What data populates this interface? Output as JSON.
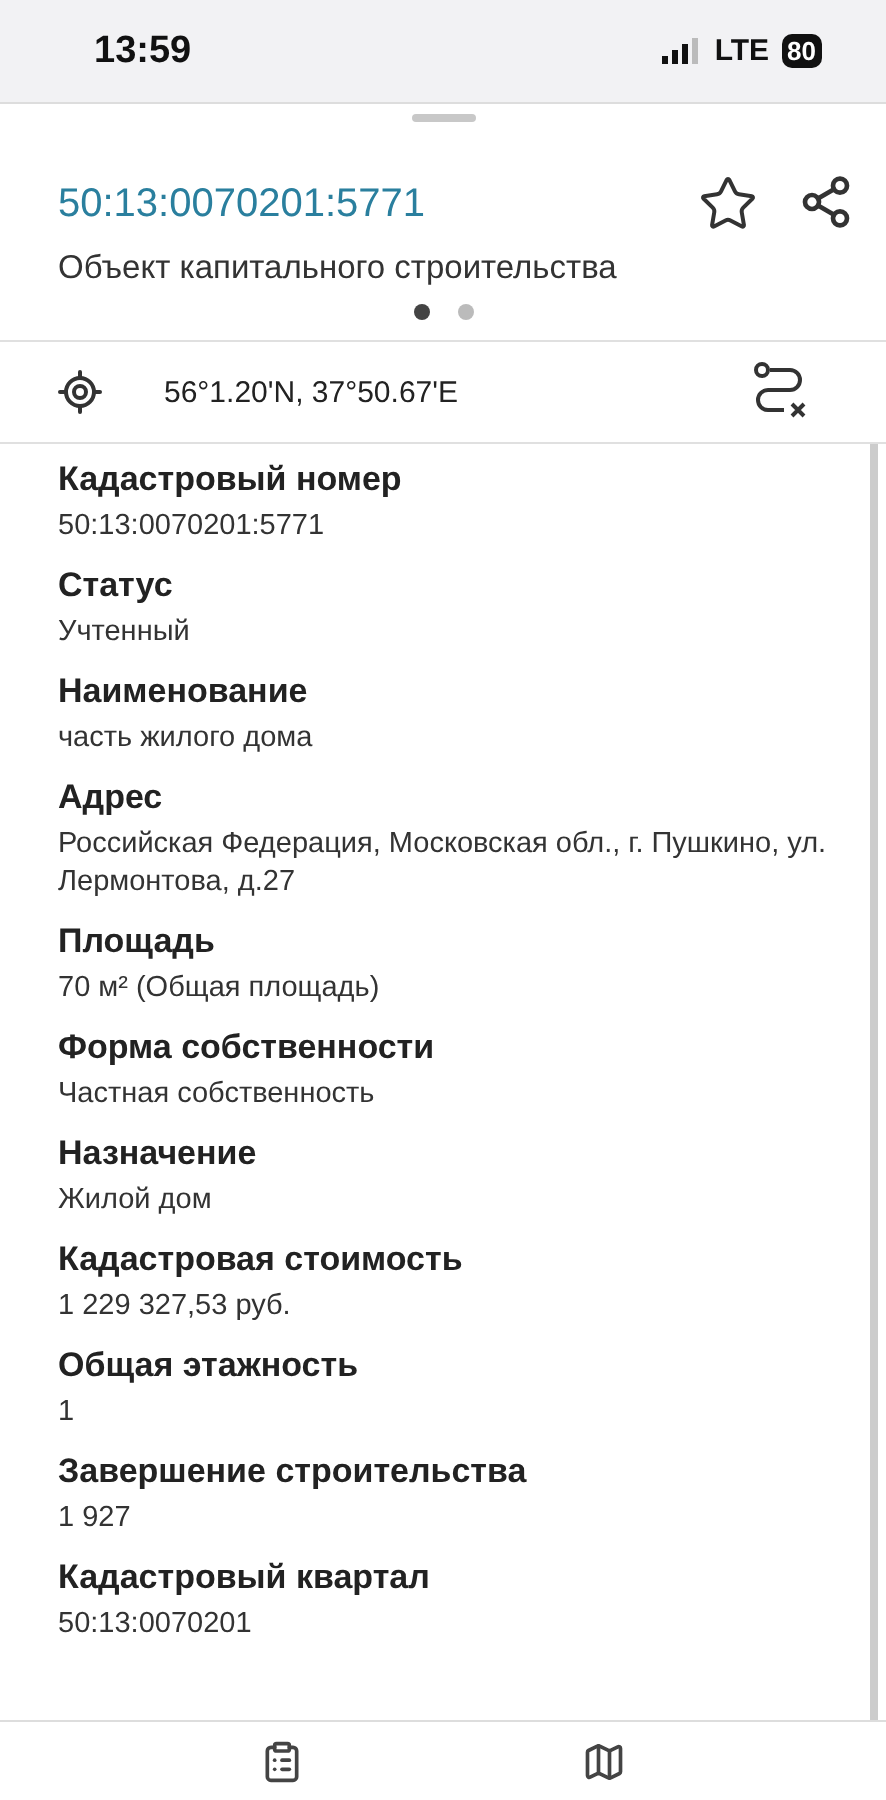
{
  "status_bar": {
    "time": "13:59",
    "network": "LTE",
    "battery": "80"
  },
  "header": {
    "cadastral_number": "50:13:0070201:5771",
    "object_type": "Объект капитального строительства"
  },
  "pages": [
    {
      "selected": true
    },
    {
      "selected": false
    }
  ],
  "location": {
    "coordinates": "56°1.20'N, 37°50.67'E"
  },
  "fields": [
    {
      "label": "Кадастровый номер",
      "value": "50:13:0070201:5771"
    },
    {
      "label": "Статус",
      "value": "Учтенный"
    },
    {
      "label": "Наименование",
      "value": "часть жилого дома"
    },
    {
      "label": "Адрес",
      "value": "Российская Федерация, Московская обл., г. Пушкино, ул. Лермонтова, д.27"
    },
    {
      "label": "Площадь",
      "value": "70 м² (Общая площадь)"
    },
    {
      "label": "Форма собственности",
      "value": "Частная собственность"
    },
    {
      "label": "Назначение",
      "value": "Жилой дом"
    },
    {
      "label": "Кадастровая стоимость",
      "value": "1 229 327,53 руб."
    },
    {
      "label": "Общая этажность",
      "value": "1"
    },
    {
      "label": "Завершение строительства",
      "value": "1 927"
    },
    {
      "label": "Кадастровый квартал",
      "value": "50:13:0070201"
    }
  ],
  "tab_bar": [
    {
      "kind": "details"
    },
    {
      "kind": "map"
    }
  ]
}
